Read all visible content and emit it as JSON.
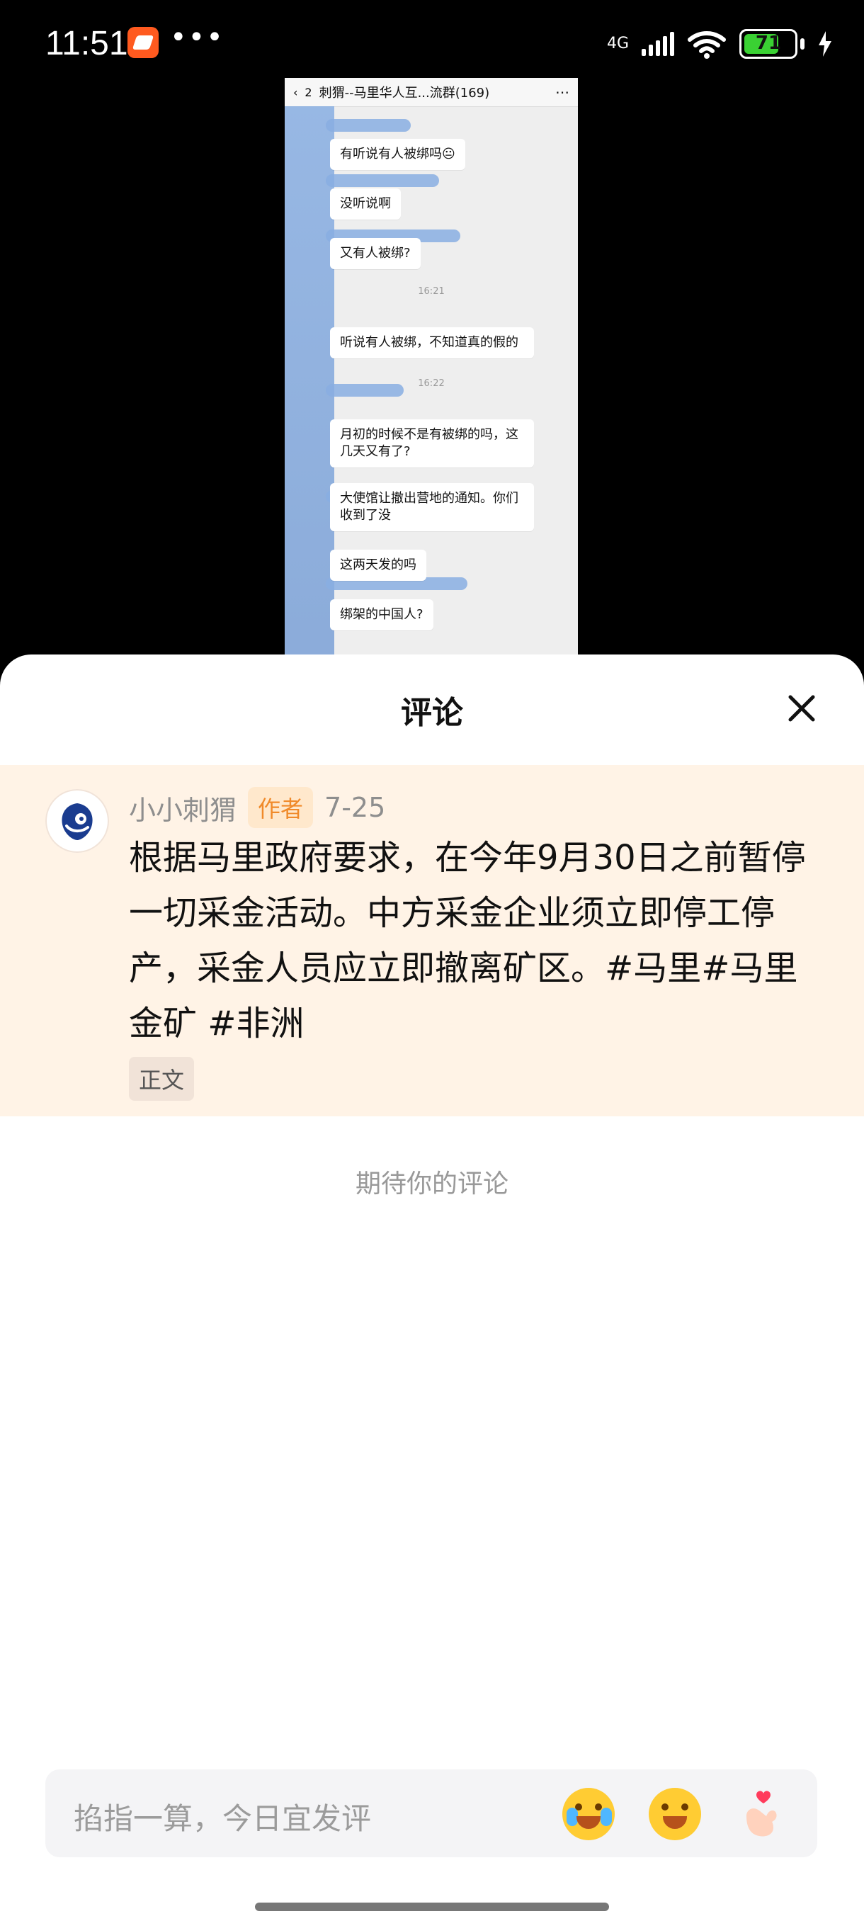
{
  "status_bar": {
    "time": "11:51",
    "network": "4G",
    "battery": "71"
  },
  "embedded_screenshot": {
    "header_title": "刺猬--马里华人互...流群(169)",
    "back_count": "2",
    "messages": [
      "有听说有人被绑吗😐",
      "没听说啊",
      "又有人被绑?",
      "听说有人被绑，不知道真的假的",
      "月初的时候不是有被绑的吗，这几天又有了?",
      "大使馆让撤出营地的通知。你们收到了没",
      "这两天发的吗",
      "绑架的中国人?"
    ],
    "timestamps": [
      "16:21",
      "16:22"
    ]
  },
  "sheet": {
    "title": "评论"
  },
  "post": {
    "author": "小小刺猬",
    "author_tag": "作者",
    "date": "7-25",
    "text": "根据马里政府要求，在今年9月30日之前暂停一切采金活动。中方采金企业须立即停工停产，采金人员应立即撤离矿区。#马里#马里金矿 #非洲",
    "badge": "正文"
  },
  "empty_hint": "期待你的评论",
  "input": {
    "placeholder": "掐指一算，今日宜发评"
  },
  "icons": {
    "close": "close-icon",
    "emoji1": "laugh-cry-emoji-icon",
    "emoji2": "grin-emoji-icon",
    "emoji3": "finger-heart-emoji-icon"
  }
}
